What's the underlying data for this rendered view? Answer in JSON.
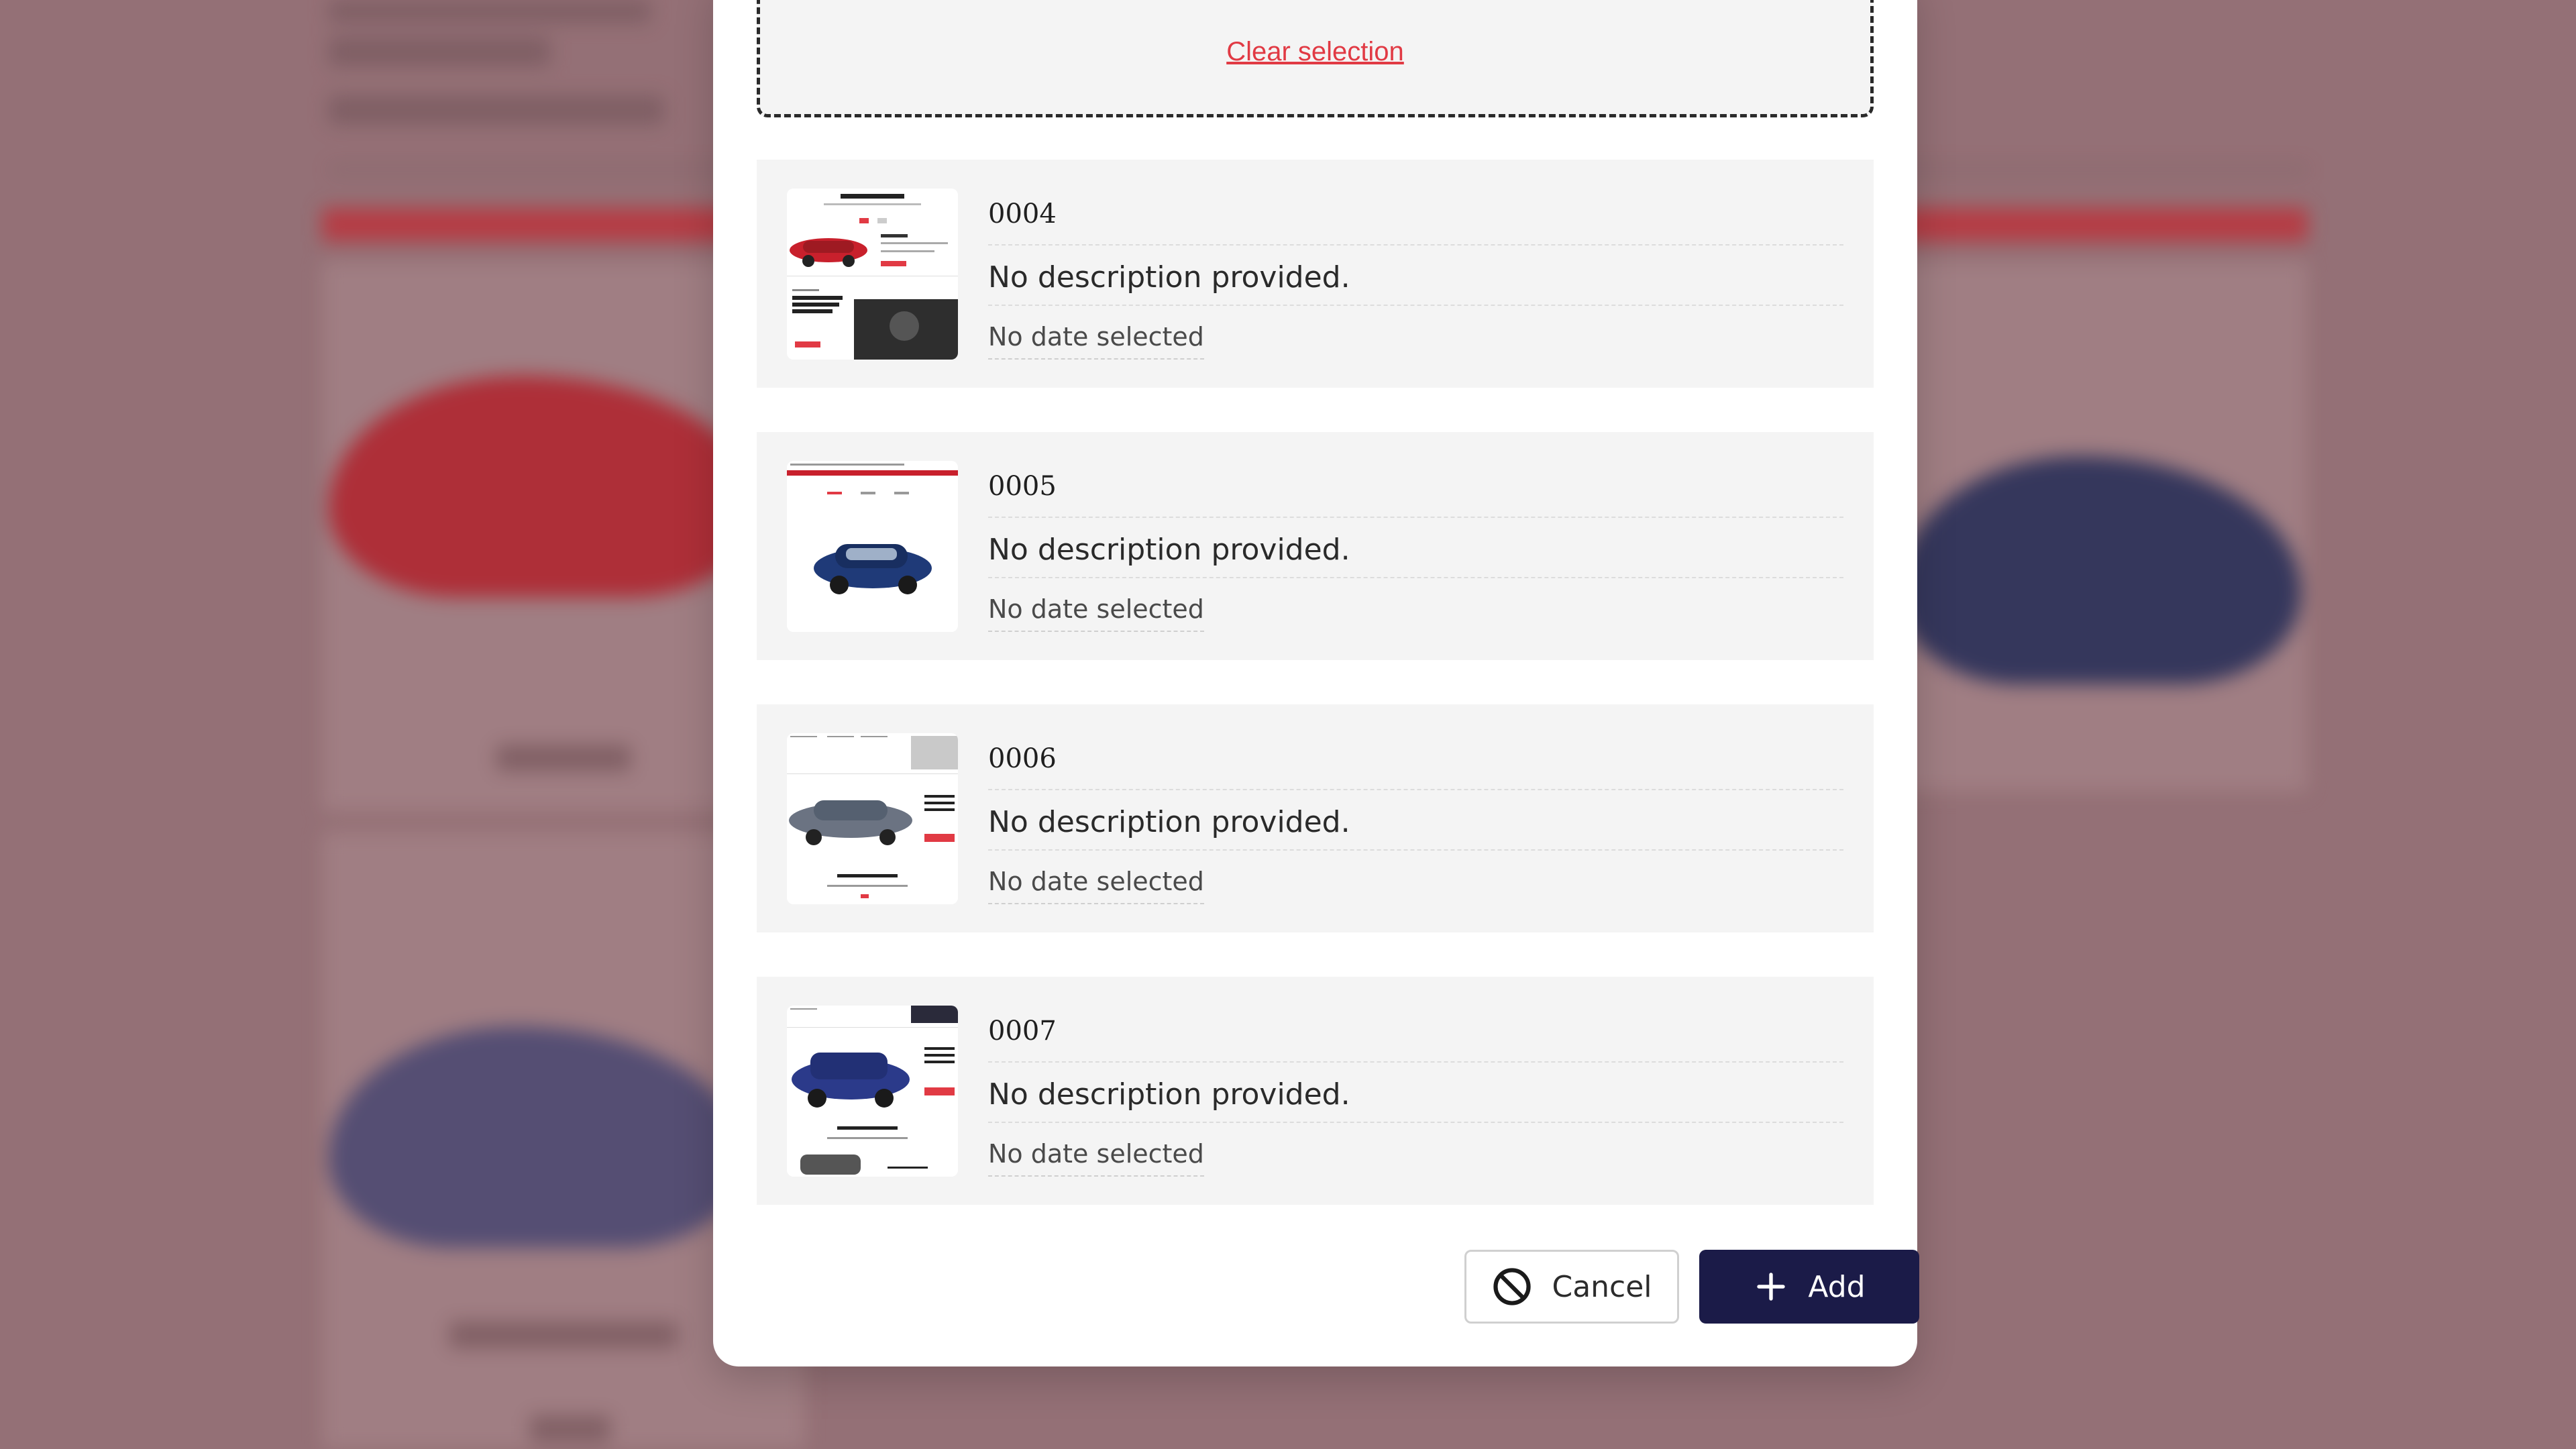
{
  "dialog": {
    "clear_selection_label": "Clear selection",
    "items": [
      {
        "id": "0004",
        "description": "No description provided.",
        "date": "No date selected",
        "thumbnail": "red-sedan-brochure"
      },
      {
        "id": "0005",
        "description": "No description provided.",
        "date": "No date selected",
        "thumbnail": "blue-sedan-page"
      },
      {
        "id": "0006",
        "description": "No description provided.",
        "date": "No date selected",
        "thumbnail": "grey-hatchback-configurator"
      },
      {
        "id": "0007",
        "description": "No description provided.",
        "date": "No date selected",
        "thumbnail": "blue-suv-configurator"
      }
    ],
    "cancel_label": "Cancel",
    "add_label": "Add",
    "icons": {
      "cancel": "ban-icon",
      "add": "plus-icon"
    }
  },
  "colors": {
    "accent": "#1b1b48",
    "link": "#e13a44",
    "item_background": "#f4f4f4",
    "backdrop": "#a38489"
  }
}
